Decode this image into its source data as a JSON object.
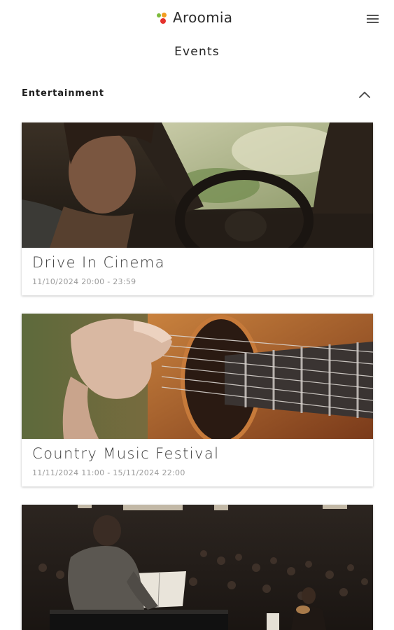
{
  "header": {
    "app_name": "Aroomia",
    "menu_icon": "hamburger-menu-icon",
    "logo_colors": {
      "green": "#7dbb3c",
      "orange": "#f29d1f",
      "red": "#e5322d"
    }
  },
  "page": {
    "title": "Events"
  },
  "section": {
    "title": "Entertainment",
    "toggle_icon": "chevron-up-icon"
  },
  "events": [
    {
      "title": "Drive In Cinema",
      "date": "11/10/2024 20:00 - 23:59"
    },
    {
      "title": "Country Music Festival",
      "date": "11/11/2024 11:00 - 15/11/2024 22:00"
    },
    {
      "title": "",
      "date": ""
    }
  ]
}
